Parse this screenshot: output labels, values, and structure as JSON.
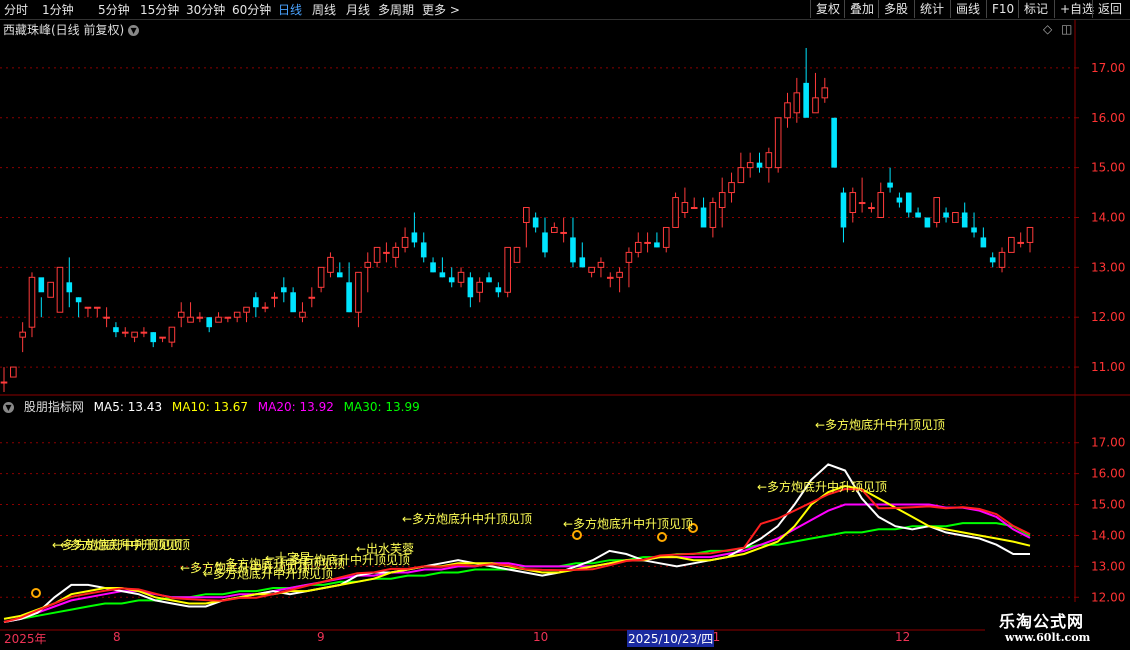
{
  "toolbar": {
    "left": [
      "分时",
      "1分钟",
      "5分钟",
      "15分钟",
      "30分钟",
      "60分钟",
      "日线",
      "周线",
      "月线",
      "多周期",
      "更多 >"
    ],
    "active": "日线",
    "right": [
      "复权",
      "叠加",
      "多股",
      "统计",
      "画线",
      "F10",
      "标记",
      "+自选",
      "返回"
    ]
  },
  "main_title": "西藏珠峰(日线 前复权)",
  "indicator": {
    "name": "股朋指标网",
    "ma5": "MA5: 13.43",
    "ma10": "MA10: 13.67",
    "ma20": "MA20: 13.92",
    "ma30": "MA30: 13.99"
  },
  "colors": {
    "up": "#ff3b3b",
    "down": "#00e5ff",
    "ma5": "#ffffff",
    "ma10": "#ffff00",
    "ma20": "#ff00ff",
    "ma30": "#00ff00",
    "ma_red": "#ff2020",
    "grid": "#8b0000",
    "axis_text": "#ff3333"
  },
  "date_axis": {
    "labels": [
      "2025年",
      "8",
      "9",
      "10",
      "11",
      "12"
    ],
    "highlight": "2025/10/23/四"
  },
  "annotations": [
    "←多方炮底升中升顶见顶",
    "←多方炮底升中升顶见顶",
    "←多方炮底升中升顶见顶",
    "←多方炮底升中升顶见顶",
    "←多方炮底升中升顶见顶",
    "←多方炮底升中升顶见顶",
    "←多方炮底升中升顶见顶",
    "←多方炮底升中升顶见顶",
    "←出水芙蓉",
    "←十字星",
    "←多方炮底升中升顶见顶",
    "←多方炮底升中升顶见顶"
  ],
  "logo": {
    "line1": "乐淘公式网",
    "line2": "www.60lt.com"
  },
  "chart_data": [
    {
      "type": "candlestick",
      "title": "西藏珠峰(日线 前复权)",
      "ylim": [
        10.5,
        17.6
      ],
      "yticks": [
        11.0,
        12.0,
        13.0,
        14.0,
        15.0,
        16.0,
        17.0
      ],
      "ohlc": [
        [
          10.7,
          11.0,
          10.5,
          10.7
        ],
        [
          10.8,
          11.0,
          10.8,
          11.0
        ],
        [
          11.6,
          11.9,
          11.3,
          11.7
        ],
        [
          11.8,
          12.9,
          11.6,
          12.8
        ],
        [
          12.8,
          12.4,
          12.0,
          12.5
        ],
        [
          12.4,
          12.7,
          12.4,
          12.7
        ],
        [
          12.1,
          13.0,
          12.1,
          13.0
        ],
        [
          12.7,
          13.2,
          12.2,
          12.5
        ],
        [
          12.4,
          12.4,
          12.0,
          12.3
        ],
        [
          12.2,
          12.2,
          12.0,
          12.2
        ],
        [
          12.2,
          12.2,
          12.0,
          12.2
        ],
        [
          12.0,
          12.2,
          11.8,
          12.0
        ],
        [
          11.8,
          11.9,
          11.6,
          11.7
        ],
        [
          11.7,
          11.8,
          11.6,
          11.7
        ],
        [
          11.6,
          11.7,
          11.5,
          11.7
        ],
        [
          11.7,
          11.8,
          11.6,
          11.7
        ],
        [
          11.7,
          11.7,
          11.4,
          11.5
        ],
        [
          11.6,
          11.6,
          11.5,
          11.6
        ],
        [
          11.5,
          11.8,
          11.4,
          11.8
        ],
        [
          12.0,
          12.3,
          11.8,
          12.1
        ],
        [
          11.9,
          12.3,
          11.9,
          12.0
        ],
        [
          12.0,
          12.1,
          11.9,
          12.0
        ],
        [
          12.0,
          12.0,
          11.7,
          11.8
        ],
        [
          11.9,
          12.1,
          11.9,
          12.0
        ],
        [
          12.0,
          12.0,
          11.9,
          12.0
        ],
        [
          12.0,
          12.1,
          11.9,
          12.1
        ],
        [
          12.1,
          12.2,
          11.9,
          12.2
        ],
        [
          12.4,
          12.5,
          12.0,
          12.2
        ],
        [
          12.2,
          12.3,
          12.1,
          12.2
        ],
        [
          12.4,
          12.5,
          12.2,
          12.4
        ],
        [
          12.6,
          12.8,
          12.3,
          12.5
        ],
        [
          12.5,
          12.6,
          12.3,
          12.1
        ],
        [
          12.0,
          12.3,
          11.9,
          12.1
        ],
        [
          12.4,
          12.6,
          12.2,
          12.4
        ],
        [
          12.6,
          13.0,
          12.5,
          13.0
        ],
        [
          12.9,
          13.3,
          12.8,
          13.2
        ],
        [
          12.9,
          13.1,
          12.9,
          12.8
        ],
        [
          12.7,
          13.1,
          12.1,
          12.1
        ],
        [
          12.1,
          12.9,
          11.8,
          12.9
        ],
        [
          13.0,
          13.3,
          12.5,
          13.1
        ],
        [
          13.1,
          13.4,
          13.0,
          13.4
        ],
        [
          13.3,
          13.5,
          13.1,
          13.3
        ],
        [
          13.2,
          13.5,
          13.0,
          13.4
        ],
        [
          13.4,
          13.8,
          13.3,
          13.6
        ],
        [
          13.7,
          14.1,
          13.4,
          13.5
        ],
        [
          13.5,
          13.7,
          13.1,
          13.2
        ],
        [
          13.1,
          13.2,
          12.9,
          12.9
        ],
        [
          12.9,
          13.2,
          12.8,
          12.8
        ],
        [
          12.8,
          13.0,
          12.6,
          12.7
        ],
        [
          12.7,
          13.0,
          12.6,
          12.9
        ],
        [
          12.8,
          12.9,
          12.2,
          12.4
        ],
        [
          12.5,
          12.8,
          12.3,
          12.7
        ],
        [
          12.8,
          12.9,
          12.7,
          12.7
        ],
        [
          12.6,
          12.7,
          12.4,
          12.5
        ],
        [
          12.5,
          13.4,
          12.4,
          13.4
        ],
        [
          13.1,
          13.4,
          13.1,
          13.4
        ],
        [
          13.9,
          14.2,
          13.4,
          14.2
        ],
        [
          14.0,
          14.1,
          13.7,
          13.8
        ],
        [
          13.7,
          14.0,
          13.2,
          13.3
        ],
        [
          13.7,
          13.9,
          13.7,
          13.8
        ],
        [
          13.7,
          14.0,
          13.5,
          13.7
        ],
        [
          13.6,
          14.0,
          13.0,
          13.1
        ],
        [
          13.2,
          13.5,
          13.0,
          13.0
        ],
        [
          12.9,
          13.0,
          12.8,
          13.0
        ],
        [
          13.0,
          13.2,
          12.8,
          13.1
        ],
        [
          12.8,
          12.9,
          12.6,
          12.8
        ],
        [
          12.8,
          13.0,
          12.5,
          12.9
        ],
        [
          13.1,
          13.4,
          12.6,
          13.3
        ],
        [
          13.3,
          13.7,
          13.2,
          13.5
        ],
        [
          13.5,
          13.7,
          13.3,
          13.5
        ],
        [
          13.5,
          13.7,
          13.4,
          13.4
        ],
        [
          13.4,
          13.8,
          13.3,
          13.8
        ],
        [
          13.8,
          14.5,
          13.8,
          14.4
        ],
        [
          14.1,
          14.6,
          14.0,
          14.3
        ],
        [
          14.2,
          14.4,
          14.2,
          14.2
        ],
        [
          14.2,
          14.4,
          14.0,
          13.8
        ],
        [
          13.8,
          14.4,
          13.6,
          14.3
        ],
        [
          14.2,
          14.8,
          13.8,
          14.5
        ],
        [
          14.5,
          14.9,
          14.3,
          14.7
        ],
        [
          14.7,
          15.3,
          14.7,
          15.0
        ],
        [
          15.0,
          15.3,
          14.8,
          15.1
        ],
        [
          15.1,
          15.3,
          14.9,
          15.0
        ],
        [
          15.0,
          15.4,
          14.7,
          15.3
        ],
        [
          15.0,
          16.0,
          14.9,
          16.0
        ],
        [
          16.0,
          16.5,
          15.8,
          16.3
        ],
        [
          16.1,
          16.8,
          15.9,
          16.5
        ],
        [
          16.7,
          17.4,
          16.2,
          16.0
        ],
        [
          16.1,
          16.9,
          16.1,
          16.4
        ],
        [
          16.4,
          16.8,
          16.3,
          16.6
        ],
        [
          16.0,
          15.0,
          15.0,
          15.0
        ],
        [
          14.5,
          14.6,
          13.5,
          13.8
        ],
        [
          14.1,
          14.6,
          13.9,
          14.5
        ],
        [
          14.3,
          14.8,
          14.1,
          14.3
        ],
        [
          14.2,
          14.3,
          14.1,
          14.2
        ],
        [
          14.0,
          14.7,
          14.0,
          14.5
        ],
        [
          14.7,
          15.0,
          14.5,
          14.6
        ],
        [
          14.4,
          14.5,
          14.2,
          14.3
        ],
        [
          14.5,
          14.5,
          14.0,
          14.1
        ],
        [
          14.1,
          14.2,
          14.0,
          14.0
        ],
        [
          14.0,
          14.0,
          13.8,
          13.8
        ],
        [
          13.9,
          14.3,
          13.8,
          14.4
        ],
        [
          14.1,
          14.2,
          13.9,
          14.0
        ],
        [
          13.9,
          14.1,
          13.9,
          14.1
        ],
        [
          14.1,
          14.3,
          13.8,
          13.8
        ],
        [
          13.8,
          14.1,
          13.6,
          13.7
        ],
        [
          13.6,
          13.8,
          13.5,
          13.4
        ],
        [
          13.2,
          13.3,
          13.0,
          13.1
        ],
        [
          13.0,
          13.4,
          12.9,
          13.3
        ],
        [
          13.3,
          13.6,
          13.3,
          13.6
        ],
        [
          13.5,
          13.7,
          13.4,
          13.5
        ],
        [
          13.5,
          13.8,
          13.3,
          13.8
        ]
      ]
    },
    {
      "type": "line",
      "title": "股朋指标网",
      "ylim": [
        11.2,
        17.8
      ],
      "yticks": [
        12.0,
        13.0,
        14.0,
        15.0,
        16.0,
        17.0
      ],
      "series": [
        {
          "name": "MA5",
          "values": [
            11.2,
            11.3,
            11.5,
            12.0,
            12.4,
            12.4,
            12.3,
            12.2,
            12.1,
            11.9,
            11.8,
            11.7,
            11.7,
            11.9,
            12.0,
            12.1,
            12.2,
            12.1,
            12.2,
            12.3,
            12.4,
            12.7,
            12.8,
            12.8,
            12.9,
            13.0,
            13.1,
            13.2,
            13.1,
            13.0,
            12.9,
            12.8,
            12.7,
            12.8,
            13.0,
            13.2,
            13.5,
            13.4,
            13.2,
            13.1,
            13.0,
            13.1,
            13.2,
            13.3,
            13.6,
            13.9,
            14.3,
            15.0,
            15.8,
            16.3,
            16.1,
            15.2,
            14.6,
            14.3,
            14.2,
            14.3,
            14.1,
            14.0,
            13.9,
            13.7,
            13.4,
            13.4
          ]
        },
        {
          "name": "MA10",
          "values": [
            11.3,
            11.4,
            11.6,
            11.8,
            12.1,
            12.2,
            12.3,
            12.3,
            12.2,
            12.0,
            11.9,
            11.8,
            11.8,
            11.9,
            12.0,
            12.1,
            12.1,
            12.2,
            12.2,
            12.3,
            12.4,
            12.5,
            12.6,
            12.8,
            12.9,
            13.0,
            13.0,
            13.1,
            13.1,
            13.1,
            13.0,
            12.9,
            12.8,
            12.8,
            12.9,
            13.0,
            13.1,
            13.2,
            13.2,
            13.3,
            13.3,
            13.2,
            13.2,
            13.3,
            13.4,
            13.6,
            13.8,
            14.3,
            15.0,
            15.4,
            15.6,
            15.5,
            15.2,
            14.9,
            14.6,
            14.3,
            14.2,
            14.1,
            14.0,
            13.9,
            13.8,
            13.67
          ]
        },
        {
          "name": "MA20",
          "values": [
            11.2,
            11.3,
            11.5,
            11.7,
            11.9,
            12.0,
            12.1,
            12.2,
            12.2,
            12.1,
            12.0,
            12.0,
            12.0,
            12.0,
            12.1,
            12.1,
            12.2,
            12.3,
            12.4,
            12.5,
            12.6,
            12.7,
            12.7,
            12.8,
            12.8,
            12.9,
            12.9,
            13.0,
            13.0,
            13.1,
            13.1,
            13.0,
            13.0,
            13.0,
            13.0,
            13.0,
            13.1,
            13.2,
            13.2,
            13.3,
            13.3,
            13.3,
            13.3,
            13.4,
            13.5,
            13.7,
            13.9,
            14.2,
            14.5,
            14.8,
            15.0,
            15.0,
            15.0,
            15.0,
            15.0,
            15.0,
            14.9,
            14.9,
            14.8,
            14.6,
            14.2,
            13.92
          ]
        },
        {
          "name": "MA30",
          "values": [
            11.2,
            11.3,
            11.4,
            11.5,
            11.6,
            11.7,
            11.8,
            11.8,
            11.9,
            11.9,
            12.0,
            12.0,
            12.1,
            12.1,
            12.2,
            12.2,
            12.3,
            12.3,
            12.4,
            12.4,
            12.5,
            12.5,
            12.6,
            12.6,
            12.7,
            12.7,
            12.8,
            12.8,
            12.9,
            12.9,
            12.9,
            13.0,
            13.0,
            13.0,
            13.1,
            13.1,
            13.2,
            13.2,
            13.3,
            13.3,
            13.4,
            13.4,
            13.5,
            13.5,
            13.6,
            13.7,
            13.7,
            13.8,
            13.9,
            14.0,
            14.1,
            14.1,
            14.2,
            14.2,
            14.3,
            14.3,
            14.3,
            14.4,
            14.4,
            14.4,
            14.3,
            13.99
          ]
        }
      ]
    }
  ]
}
